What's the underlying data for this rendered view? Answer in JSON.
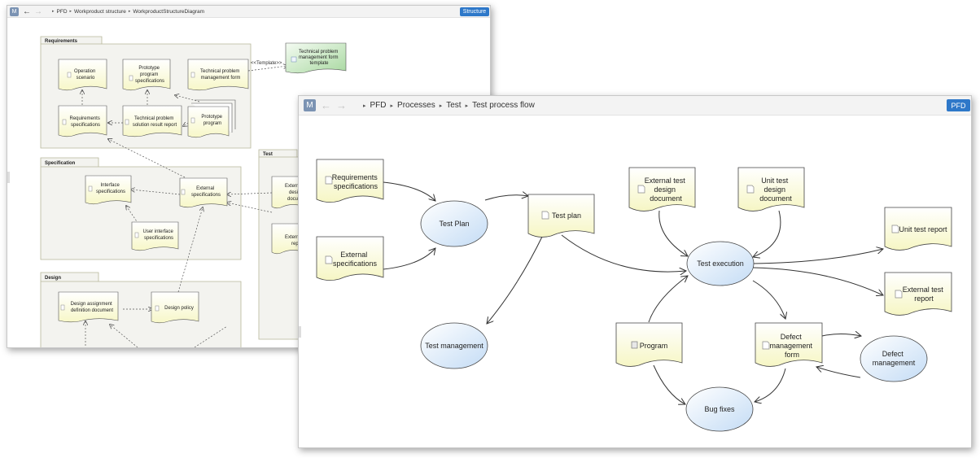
{
  "back_window": {
    "menu_letter": "M",
    "back_arrow": "←",
    "forward_arrow": "→",
    "breadcrumb": [
      "PFD",
      "Workproduct structure",
      "WorkproductStructureDiagram"
    ],
    "view_tag": "Structure",
    "groups": {
      "requirements": "Requirements",
      "specification": "Specification",
      "test": "Test",
      "design": "Design"
    },
    "docs": {
      "operation_scenario": [
        "Operation",
        "scenario"
      ],
      "prototype_program_specs": [
        "Prototype",
        "program",
        "specifications"
      ],
      "technical_problem_form": [
        "Technical problem",
        "management form"
      ],
      "requirements_specs": [
        "Requirements",
        "specifications"
      ],
      "solution_report": [
        "Technical problem",
        "solution result report"
      ],
      "prototype_program": [
        "Prototype",
        "program"
      ],
      "template": [
        "Technical problem",
        "management form",
        "template"
      ],
      "interface_specs": [
        "Interface",
        "specifications"
      ],
      "external_specs": [
        "External",
        "specifications"
      ],
      "ui_specs": [
        "User interface",
        "specifications"
      ],
      "test_doc_1": [
        "Extern",
        "desi",
        "docu"
      ],
      "test_doc_2": [
        "Extern",
        "rep"
      ],
      "design_assignment": [
        "Design assignment",
        "definition document"
      ],
      "design_policy": [
        "Design policy"
      ]
    },
    "template_stereotype": "<<Template>>"
  },
  "front_window": {
    "menu_letter": "M",
    "back_arrow": "←",
    "forward_arrow": "→",
    "breadcrumb": [
      "PFD",
      "Processes",
      "Test",
      "Test process flow"
    ],
    "view_tag": "PFD",
    "docs": {
      "requirements_specs": [
        "Requirements",
        "specifications"
      ],
      "external_specs": [
        "External",
        "specifications"
      ],
      "test_plan_doc": [
        "Test plan"
      ],
      "external_test_design_doc": [
        "External test",
        "design",
        "document"
      ],
      "unit_test_design_doc": [
        "Unit test",
        "design",
        "document"
      ],
      "unit_test_report": [
        "Unit test report"
      ],
      "external_test_report": [
        "External test",
        "report"
      ],
      "program": [
        "Program"
      ],
      "defect_form": [
        "Defect",
        "management",
        "form"
      ]
    },
    "processes": {
      "test_plan": [
        "Test Plan"
      ],
      "test_execution": [
        "Test execution"
      ],
      "test_management": [
        "Test management"
      ],
      "bug_fixes": [
        "Bug fixes"
      ],
      "defect_management": [
        "Defect",
        "management"
      ]
    }
  },
  "colors": {
    "accent_blue": "#2e78c9",
    "menu_button": "#7b93b3",
    "document_fill": "#fcfce2",
    "process_fill": "#dcebfa",
    "template_fill": "#c9e8c4",
    "group_fill": "#f3f3ef"
  }
}
